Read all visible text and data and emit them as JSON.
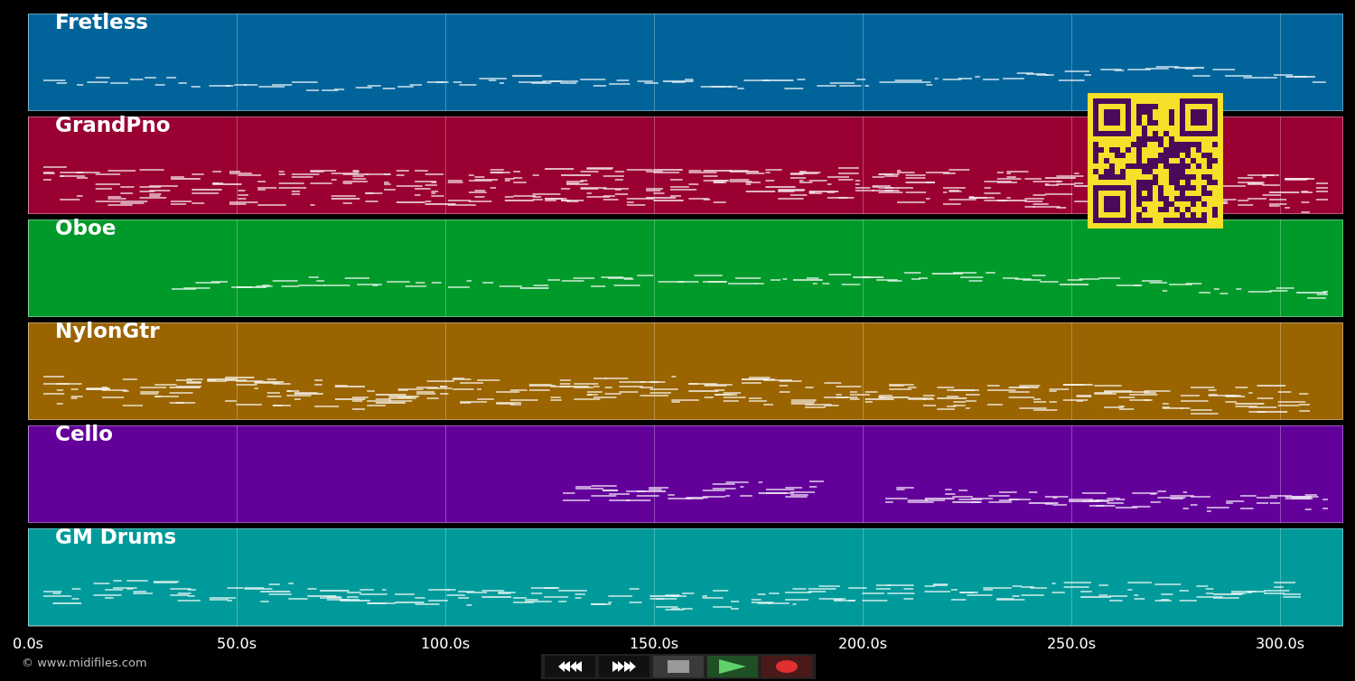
{
  "tracks": [
    {
      "name": "Fretless",
      "color": "#00649a"
    },
    {
      "name": "GrandPno",
      "color": "#9a0032"
    },
    {
      "name": "Oboe",
      "color": "#009a2a"
    },
    {
      "name": "NylonGtr",
      "color": "#9a6400"
    },
    {
      "name": "Cello",
      "color": "#64009a"
    },
    {
      "name": "GM Drums",
      "color": "#009a9a"
    }
  ],
  "axis": {
    "ticks": [
      "0.0s",
      "50.0s",
      "100.0s",
      "150.0s",
      "200.0s",
      "250.0s",
      "300.0s"
    ]
  },
  "controls": [
    {
      "kind": "rewind"
    },
    {
      "kind": "forward"
    },
    {
      "kind": "stop"
    },
    {
      "kind": "play"
    },
    {
      "kind": "record"
    }
  ],
  "footer": "© www.midifiles.com"
}
